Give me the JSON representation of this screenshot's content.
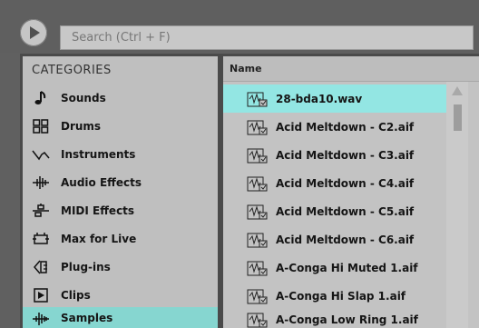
{
  "search": {
    "placeholder": "Search (Ctrl + F)"
  },
  "sidebar": {
    "title": "CATEGORIES",
    "items": [
      {
        "label": "Sounds",
        "icon": "note-icon"
      },
      {
        "label": "Drums",
        "icon": "grid-icon"
      },
      {
        "label": "Instruments",
        "icon": "wave-icon"
      },
      {
        "label": "Audio Effects",
        "icon": "audio-effect-icon"
      },
      {
        "label": "MIDI Effects",
        "icon": "midi-effect-icon"
      },
      {
        "label": "Max for Live",
        "icon": "max-for-live-icon"
      },
      {
        "label": "Plug-ins",
        "icon": "plugin-icon"
      },
      {
        "label": "Clips",
        "icon": "clip-icon"
      },
      {
        "label": "Samples",
        "icon": "sample-icon",
        "selected": true
      }
    ]
  },
  "browser": {
    "column_header": "Name",
    "files": [
      {
        "label": "28-bda10.wav",
        "selected": true
      },
      {
        "label": "Acid Meltdown - C2.aif"
      },
      {
        "label": "Acid Meltdown - C3.aif"
      },
      {
        "label": "Acid Meltdown - C4.aif"
      },
      {
        "label": "Acid Meltdown - C5.aif"
      },
      {
        "label": "Acid Meltdown - C6.aif"
      },
      {
        "label": "A-Conga Hi Muted 1.aif"
      },
      {
        "label": "A-Conga Hi Slap 1.aif"
      },
      {
        "label": "A-Conga Low Ring 1.aif"
      }
    ]
  },
  "colors": {
    "selection_sidebar": "#86d6d0",
    "selection_file": "#93e6e3"
  }
}
